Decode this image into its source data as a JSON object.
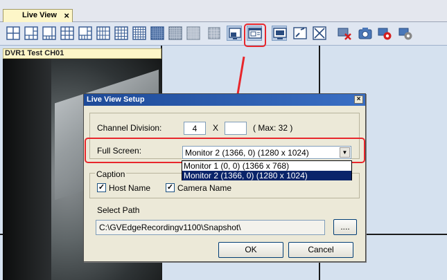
{
  "tab": {
    "label": "Live View",
    "close": "×"
  },
  "toolbar": {
    "icons": [
      "layout-1x1-icon",
      "layout-1plus5-icon",
      "layout-1plus7-icon",
      "layout-3x3-icon",
      "layout-1plus9-icon",
      "layout-1plus12-icon",
      "layout-4x4-icon",
      "layout-5x5-icon",
      "layout-6x6-icon",
      "layout-7x7-icon",
      "layout-8x8-icon",
      "custom-layout-icon",
      "live-view-setup-icon",
      "fullscreen-monitor-icon",
      "auto-fit-icon",
      "stretch-icon",
      "disconnect-camera-icon",
      "snapshot-icon",
      "record-icon",
      "record-settings-icon"
    ]
  },
  "camera": {
    "title": "DVR1 Test CH01"
  },
  "dialog": {
    "title": "Live View Setup",
    "close": "×",
    "channel_division_label": "Channel Division:",
    "channel_cols": "4",
    "x_label": "X",
    "channel_rows": "",
    "max_label": "( Max: 32 )",
    "full_screen_label": "Full Screen:",
    "full_screen_value": "Monitor 2   (1366, 0) (1280 x 1024)",
    "options": [
      "Monitor 1   (0, 0) (1366 x 768)",
      "Monitor 2   (1366, 0) (1280 x 1024)"
    ],
    "caption_label": "Caption",
    "host_name_label": "Host Name",
    "camera_name_label": "Camera Name",
    "host_name_checked": true,
    "camera_name_checked": true,
    "select_path_label": "Select Path",
    "path_value": "C:\\GVEdgeRecordingv1100\\Snapshot\\",
    "browse_label": "....",
    "ok_label": "OK",
    "cancel_label": "Cancel"
  },
  "colors": {
    "annotation": "#e8262b",
    "title_bar": "#1e4a98",
    "selection": "#0a246a"
  }
}
